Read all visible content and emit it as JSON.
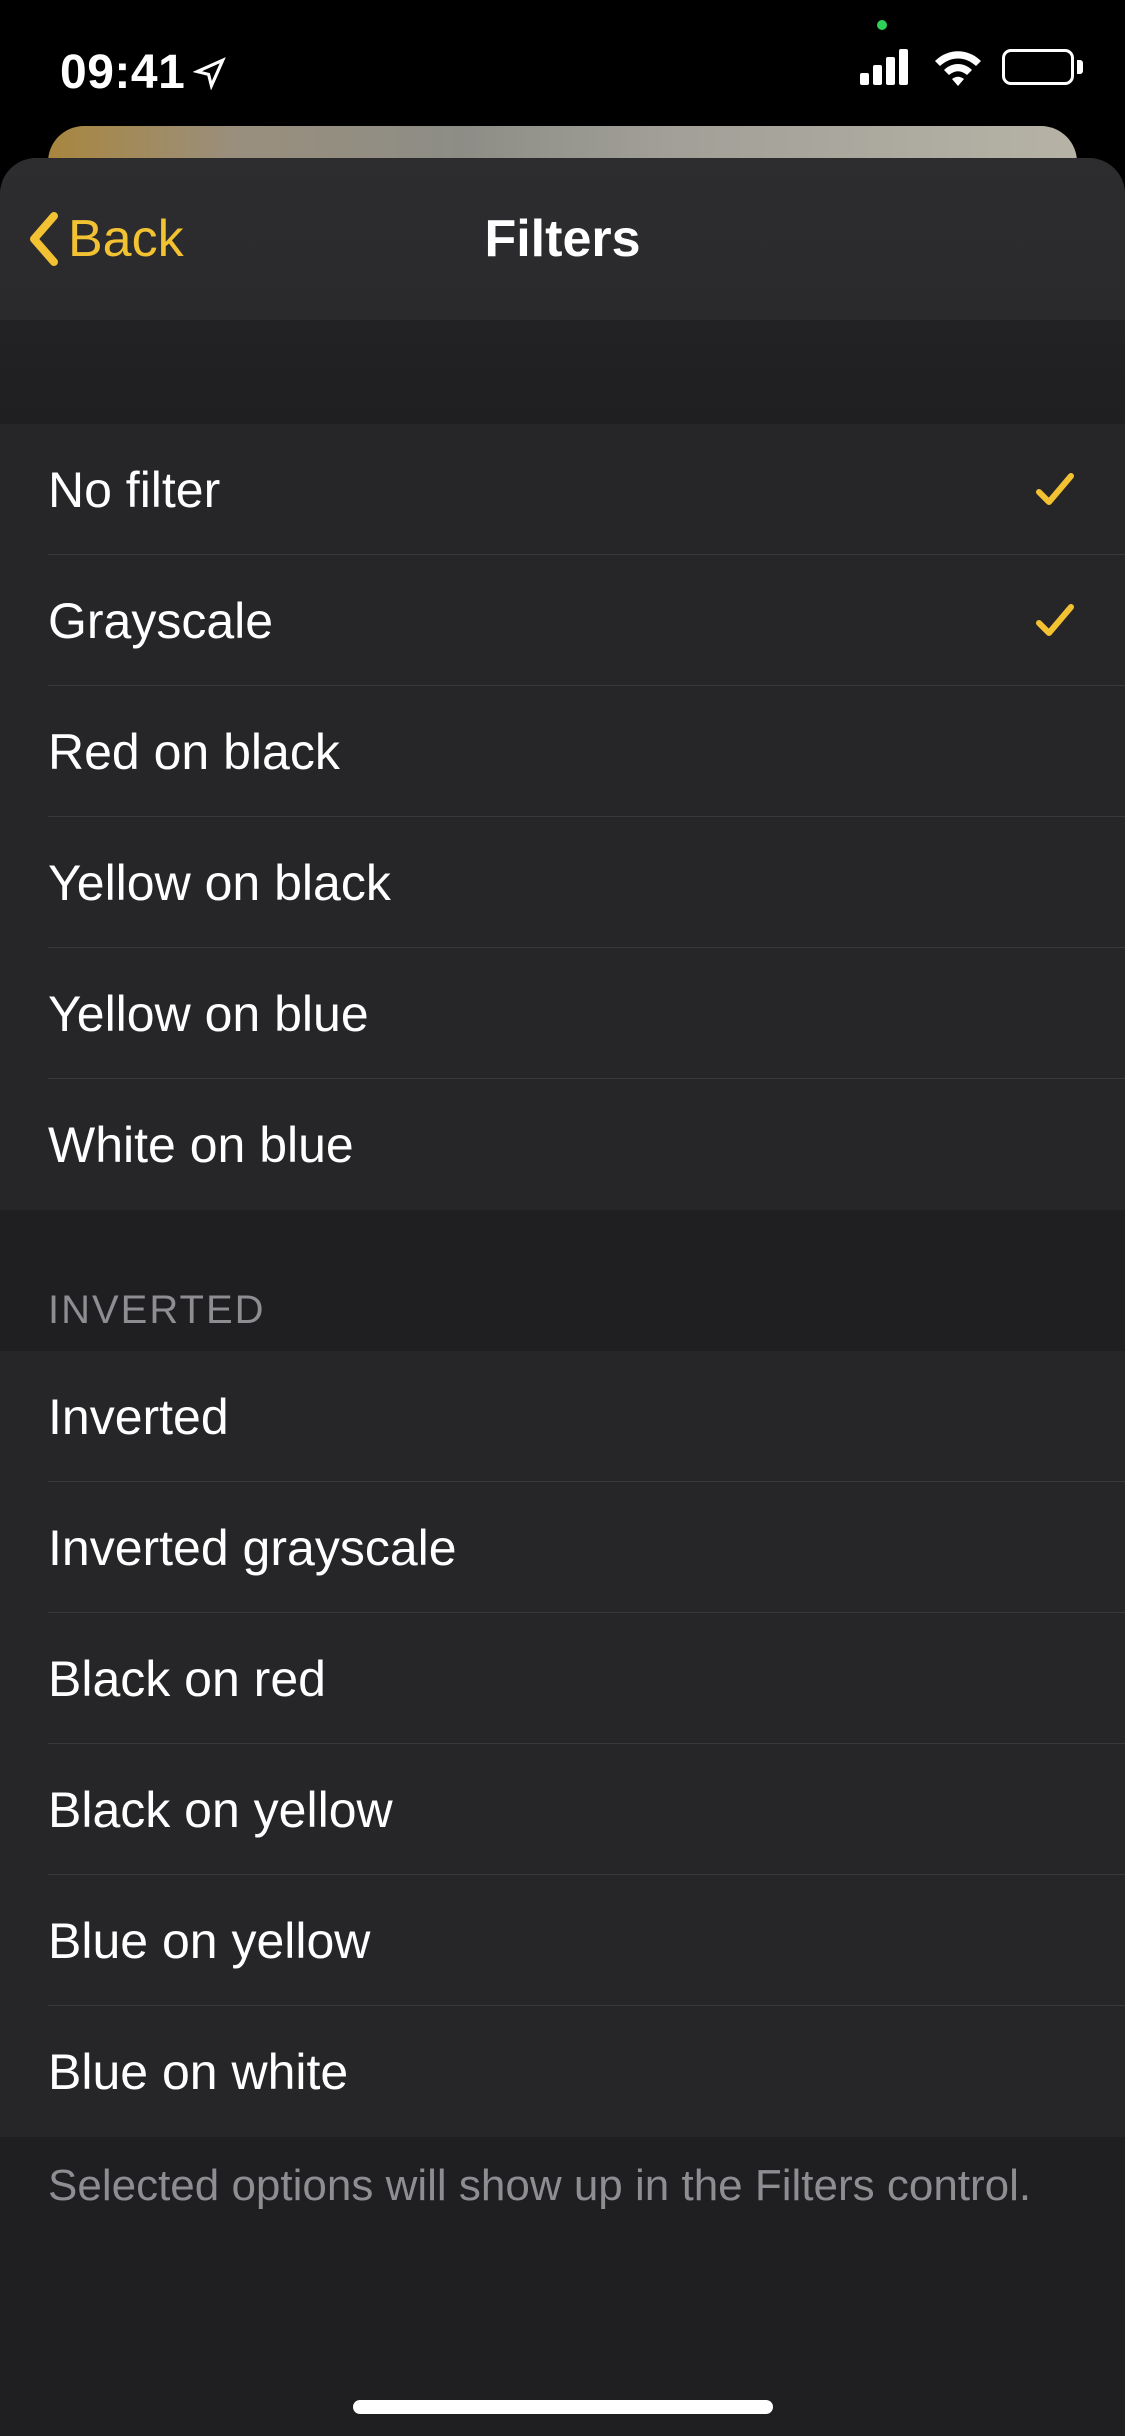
{
  "status": {
    "time": "09:41"
  },
  "nav": {
    "back_label": "Back",
    "title": "Filters"
  },
  "section1": {
    "items": [
      {
        "label": "No filter",
        "checked": true
      },
      {
        "label": "Grayscale",
        "checked": true
      },
      {
        "label": "Red on black",
        "checked": false
      },
      {
        "label": "Yellow on black",
        "checked": false
      },
      {
        "label": "Yellow on blue",
        "checked": false
      },
      {
        "label": "White on blue",
        "checked": false
      }
    ]
  },
  "section2": {
    "header": "INVERTED",
    "items": [
      {
        "label": "Inverted",
        "checked": false
      },
      {
        "label": "Inverted grayscale",
        "checked": false
      },
      {
        "label": "Black on red",
        "checked": false
      },
      {
        "label": "Black on yellow",
        "checked": false
      },
      {
        "label": "Blue on yellow",
        "checked": false
      },
      {
        "label": "Blue on white",
        "checked": false
      }
    ]
  },
  "footer_note": "Selected options will show up in the Filters control.",
  "colors": {
    "accent": "#f3c232"
  }
}
